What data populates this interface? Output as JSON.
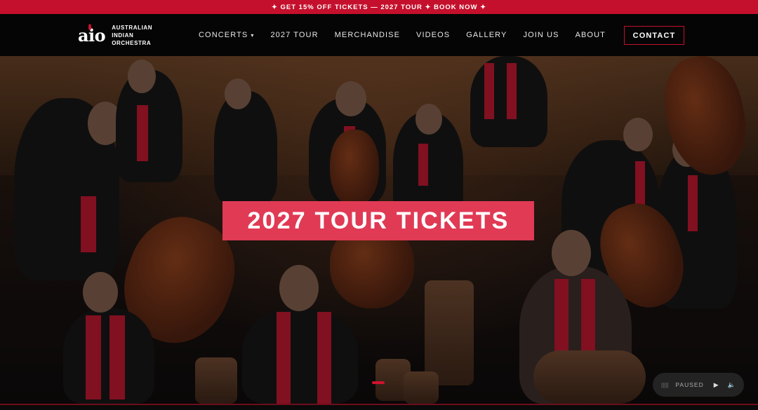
{
  "promo": {
    "text": "✦ GET 15% OFF TICKETS — 2027 TOUR ✦ BOOK NOW ✦"
  },
  "logo": {
    "mark": "aio",
    "line1": "AUSTRALIAN",
    "line2": "INDIAN",
    "line3": "ORCHESTRA"
  },
  "nav": {
    "items": [
      {
        "label": "CONCERTS",
        "has_dropdown": true
      },
      {
        "label": "2027 TOUR"
      },
      {
        "label": "MERCHANDISE"
      },
      {
        "label": "VIDEOS"
      },
      {
        "label": "GALLERY"
      },
      {
        "label": "JOIN US"
      },
      {
        "label": "ABOUT"
      }
    ],
    "dropdown_caret": "▾",
    "contact_label": "CONTACT"
  },
  "hero": {
    "cta_label": "2027 TOUR TICKETS",
    "slide_count_visible": 1
  },
  "audio": {
    "bars": "|||||",
    "status": "PAUSED",
    "play_icon": "▶",
    "volume_icon": "🔈"
  },
  "colors": {
    "accent": "#c4102c",
    "cta": "#e03a55",
    "nav_bg": "#050505"
  }
}
